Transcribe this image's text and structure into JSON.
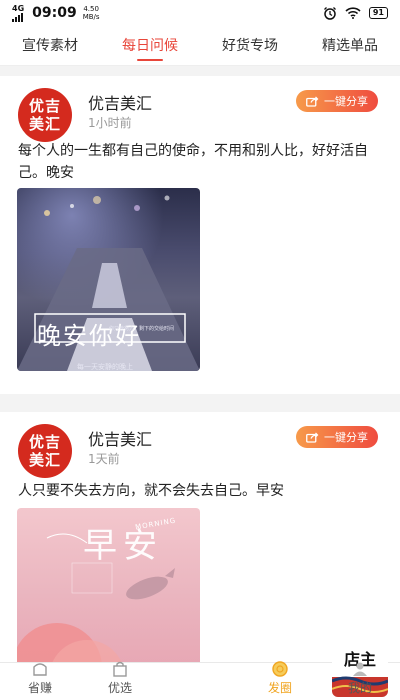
{
  "status_bar": {
    "network": "4G",
    "time": "09:09",
    "speed_value": "4.50",
    "speed_unit": "MB/s",
    "battery": "91"
  },
  "tabs": [
    {
      "label": "宣传素材",
      "active": false
    },
    {
      "label": "每日问候",
      "active": true
    },
    {
      "label": "好货专场",
      "active": false
    },
    {
      "label": "精选单品",
      "active": false
    }
  ],
  "posts": [
    {
      "avatar_top": "优吉",
      "avatar_bottom": "美汇",
      "author": "优吉美汇",
      "time": "1小时前",
      "share_label": "一键分享",
      "text": "每个人的一生都有自己的使命，不用和别人比，好好活自己。晚安",
      "image": {
        "main_text": "晚安你好",
        "small_text": "你只管努力，剩下的交给时间",
        "bottom_text": "每一天安静的晚上"
      }
    },
    {
      "avatar_top": "优吉",
      "avatar_bottom": "美汇",
      "author": "优吉美汇",
      "time": "1天前",
      "share_label": "一键分享",
      "text": "人只要不失去方向，就不会失去自己。早安",
      "image": {
        "main_text": "早安",
        "small_text": "MORNING"
      }
    }
  ],
  "bottom_nav": [
    {
      "label": "省赚",
      "active": false
    },
    {
      "label": "优选",
      "active": false
    },
    {
      "label": "",
      "active": false
    },
    {
      "label": "发圈",
      "active": true
    },
    {
      "label": "我的",
      "active": false
    }
  ],
  "center_logo_text": "店主",
  "colors": {
    "accent": "#e8463a",
    "nav_active": "#f0a521",
    "brand_red": "#d42a1e"
  }
}
